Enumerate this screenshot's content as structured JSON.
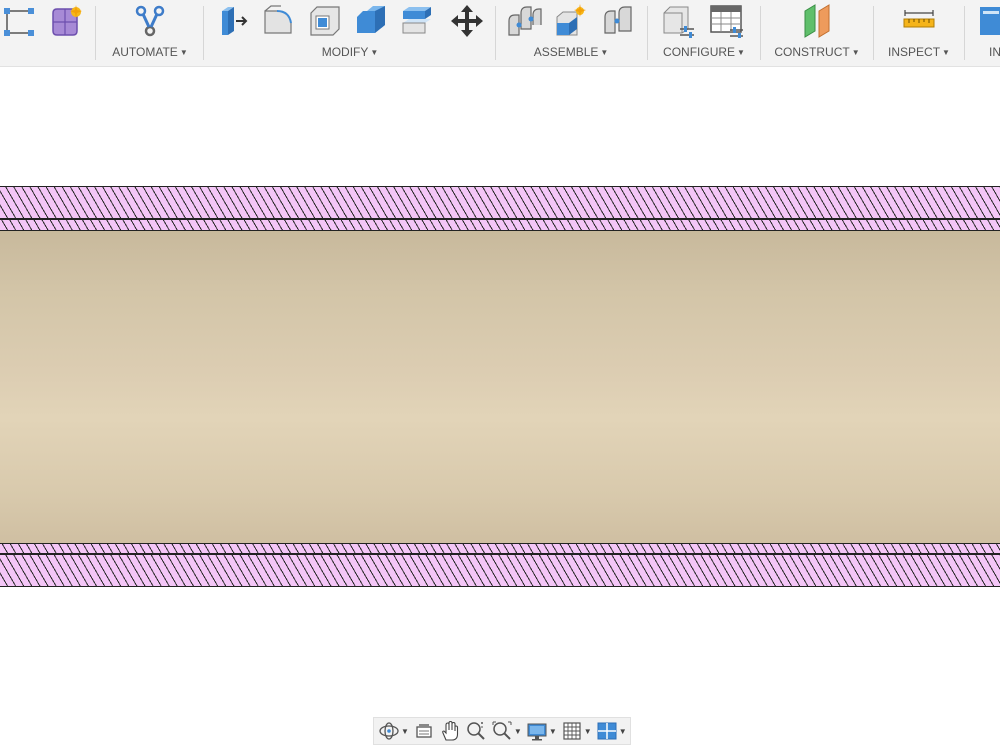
{
  "toolbar": {
    "groups": [
      {
        "label": "AUTOMATE"
      },
      {
        "label": "MODIFY"
      },
      {
        "label": "ASSEMBLE"
      },
      {
        "label": "CONFIGURE"
      },
      {
        "label": "CONSTRUCT"
      },
      {
        "label": "INSPECT"
      },
      {
        "label": "IN"
      }
    ],
    "tools": {
      "sketch_constraint": {
        "icon": "constraint-icon"
      },
      "create_form": {
        "icon": "form-icon"
      },
      "automate": {
        "icon": "automate-icon"
      },
      "press_pull": {
        "icon": "press-pull-icon"
      },
      "fillet": {
        "icon": "fillet-icon"
      },
      "shell": {
        "icon": "shell-icon"
      },
      "combine": {
        "icon": "combine-icon"
      },
      "offset_face": {
        "icon": "offset-face-icon"
      },
      "move": {
        "icon": "move-icon"
      },
      "joint": {
        "icon": "joint-icon"
      },
      "new_component": {
        "icon": "new-component-icon"
      },
      "as_built_joint": {
        "icon": "as-built-joint-icon"
      },
      "configure_model": {
        "icon": "configure-model-icon"
      },
      "configuration_table": {
        "icon": "configuration-table-icon"
      },
      "construct_plane": {
        "icon": "construct-plane-icon"
      },
      "measure": {
        "icon": "measure-icon"
      }
    }
  },
  "viewport": {
    "hatch_color": "#f4c6f7",
    "body_color": "#d8c9ac"
  },
  "navbar": {
    "tools": [
      {
        "name": "orbit-icon",
        "has_dropdown": true
      },
      {
        "name": "look-at-icon",
        "has_dropdown": false
      },
      {
        "name": "pan-icon",
        "has_dropdown": false
      },
      {
        "name": "zoom-icon",
        "has_dropdown": false
      },
      {
        "name": "fit-icon",
        "has_dropdown": true
      },
      {
        "name": "display-settings-icon",
        "has_dropdown": true
      },
      {
        "name": "grid-icon",
        "has_dropdown": true
      },
      {
        "name": "viewports-icon",
        "has_dropdown": true
      }
    ]
  }
}
